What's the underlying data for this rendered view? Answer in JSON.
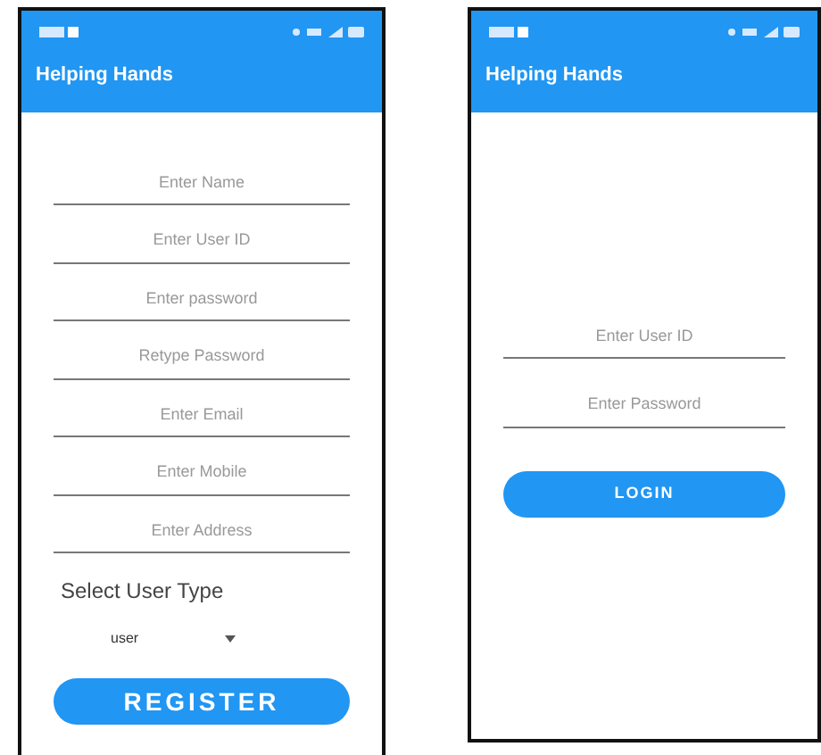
{
  "screens": [
    {
      "kind": "register",
      "app_title": "Helping Hands",
      "fields": [
        {
          "placeholder": "Enter Name"
        },
        {
          "placeholder": "Enter User ID"
        },
        {
          "placeholder": "Enter password"
        },
        {
          "placeholder": "Retype Password"
        },
        {
          "placeholder": "Enter Email"
        },
        {
          "placeholder": "Enter Mobile"
        },
        {
          "placeholder": "Enter Address"
        }
      ],
      "select_label": "Select User Type",
      "select_value": "user",
      "button": "REGISTER"
    },
    {
      "kind": "login",
      "app_title": "Helping Hands",
      "fields": [
        {
          "placeholder": "Enter User ID"
        },
        {
          "placeholder": "Enter Password"
        }
      ],
      "button": "LOGIN"
    }
  ]
}
